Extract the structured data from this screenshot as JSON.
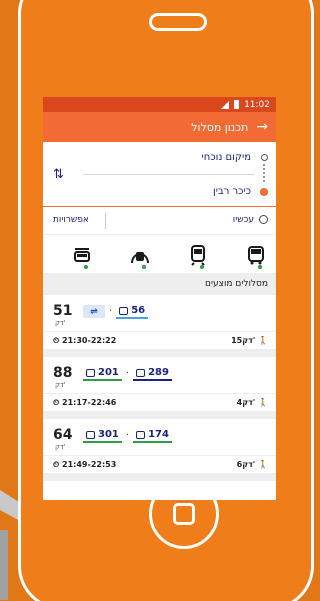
{
  "status_bar": {
    "time": "11:02"
  },
  "app_bar": {
    "title": "תכנון מסלול",
    "back_icon": "arrow-right-icon"
  },
  "route": {
    "from": "מיקום נוכחי",
    "to": "כיכר רבין",
    "swap_icon": "swap-icon"
  },
  "options": {
    "time": "עכשיו",
    "options_label": "אפשרויות"
  },
  "modes": [
    "bus-icon",
    "train-icon",
    "light-rail-icon",
    "cablecar-icon"
  ],
  "suggested": {
    "title": "מסלולים מוצעים",
    "routes": [
      {
        "duration": "51",
        "unit": "דק'",
        "lines": [
          "56"
        ],
        "rail": true,
        "times": "21:30-22:22",
        "walk": "15דק'"
      },
      {
        "duration": "88",
        "unit": "דק'",
        "lines": [
          "289",
          "201"
        ],
        "rail": false,
        "times": "21:17-22:46",
        "walk": "4דק'"
      },
      {
        "duration": "64",
        "unit": "דק'",
        "lines": [
          "174",
          "301"
        ],
        "rail": false,
        "times": "21:49-22:53",
        "walk": "6דק'"
      }
    ]
  },
  "colors": {
    "accent": "#f26a34",
    "background": "#e07818",
    "line_text": "#1a237e"
  }
}
